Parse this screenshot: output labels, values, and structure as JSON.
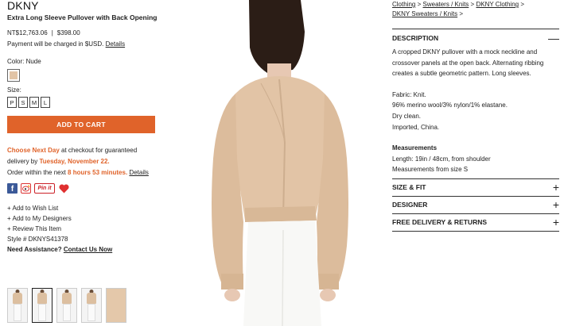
{
  "product": {
    "brand": "DKNY",
    "title": "Extra Long Sleeve Pullover with Back Opening",
    "price_local": "NT$12,763.06",
    "price_separator": "|",
    "price_usd": "$398.00",
    "charge_note": "Payment will be charged in $USD.",
    "details_link": "Details",
    "color_label": "Color: Nude",
    "size_label": "Size:",
    "sizes": [
      "P",
      "S",
      "M",
      "L"
    ],
    "add_to_cart": "ADD TO CART",
    "swatch_color": "#e2c4a6",
    "accent_color": "#e0632a"
  },
  "delivery": {
    "choose": "Choose Next Day",
    "text1": " at checkout for guaranteed delivery by ",
    "date": "Tuesday, November 22.",
    "text2": "Order within the next ",
    "countdown": "8 hours 53 minutes.",
    "details": "Details"
  },
  "share": {
    "facebook": "f",
    "pinterest": "Pin it"
  },
  "actions": {
    "wishlist": "+ Add to Wish List",
    "designers": "+ Add to My Designers",
    "review": "+ Review This Item",
    "style": "Style # DKNYS41378",
    "assist": "Need Assistance?",
    "contact": "Contact Us Now"
  },
  "breadcrumbs": {
    "clothing": "Clothing",
    "sweaters": "Sweaters / Knits",
    "dkny_clothing": "DKNY Clothing",
    "dkny_sweaters": "DKNY Sweaters / Knits",
    "sep": ">"
  },
  "description": {
    "heading": "DESCRIPTION",
    "collapse_icon": "minus-icon",
    "body": "A cropped DKNY pullover with a mock neckline and crossover panels at the open back. Alternating ribbing creates a subtle geometric pattern. Long sleeves.",
    "fabric": "Fabric: Knit.",
    "composition": "96% merino wool/3% nylon/1% elastane.",
    "care": "Dry clean.",
    "origin": "Imported, China.",
    "measurements_title": "Measurements",
    "length": "Length: 19in / 48cm, from shoulder",
    "size_note": "Measurements from size S"
  },
  "sections": [
    {
      "label": "SIZE & FIT",
      "icon": "plus-icon"
    },
    {
      "label": "DESIGNER",
      "icon": "plus-icon"
    },
    {
      "label": "FREE DELIVERY & RETURNS",
      "icon": "plus-icon"
    }
  ]
}
